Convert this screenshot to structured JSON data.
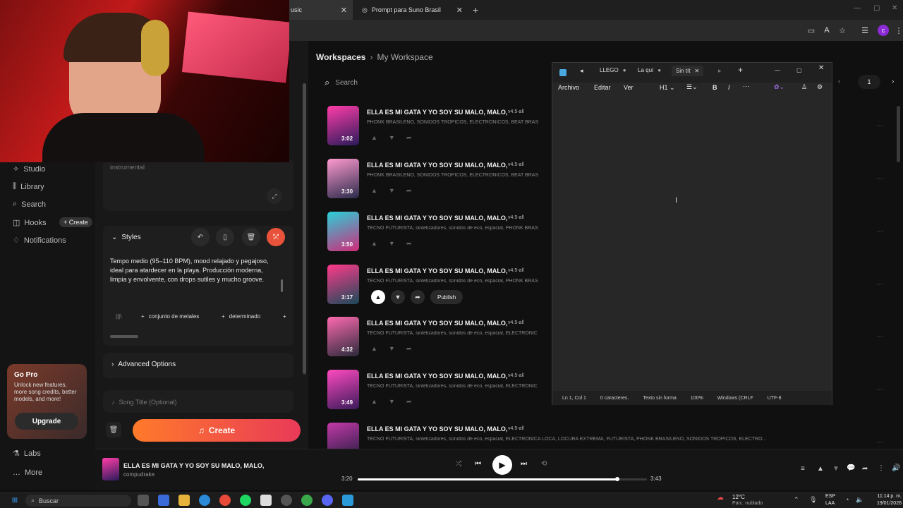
{
  "browser": {
    "tabs": [
      {
        "label": "usic"
      },
      {
        "label": "Prompt para Suno Brasil"
      }
    ],
    "new_tab": "+",
    "profile_initial": "c"
  },
  "sidebar": {
    "items": [
      {
        "label": "Studio",
        "icon": "studio-icon"
      },
      {
        "label": "Library",
        "icon": "library-icon"
      },
      {
        "label": "Search",
        "icon": "search-icon"
      },
      {
        "label": "Hooks",
        "icon": "hooks-icon"
      },
      {
        "label": "Notifications",
        "icon": "bell-icon"
      }
    ],
    "create_pill": "+ Create",
    "go_pro": {
      "title": "Go Pro",
      "text": "Unlock new features, more song credits, better models, and more!",
      "button": "Upgrade"
    },
    "labs": "Labs",
    "more": "More"
  },
  "create_panel": {
    "lyrics_placeholder": "instrumental",
    "styles_label": "Styles",
    "styles_text": "Tempo medio (95–110 BPM), mood relajado y pegajoso, ideal para atardecer en la playa. Producción moderna, limpia y envolvente, con drops sutiles y mucho groove.",
    "chips": [
      "conjunto de metales",
      "determinado"
    ],
    "advanced_options": "Advanced Options",
    "song_title_placeholder": "Song Title (Optional)",
    "create_button": "Create"
  },
  "workspace": {
    "breadcrumb_root": "Workspaces",
    "breadcrumb_current": "My Workspace",
    "search_placeholder": "Search",
    "page": "1"
  },
  "songs": [
    {
      "title": "ELLA ES MI GATA Y YO SOY SU MALO, MALO,",
      "version": "v4.5-all",
      "tags": "PHONK BRASILEÑO, SONIDOS TROPICOS, ELECTRONICOS, BEAT BRAS",
      "duration": "3:02"
    },
    {
      "title": "ELLA ES MI GATA Y YO SOY SU MALO, MALO,",
      "version": "v4.5-all",
      "tags": "PHONK BRASILEÑO, SONIDOS TROPICOS, ELECTRONICOS, BEAT BRAS",
      "duration": "3:30"
    },
    {
      "title": "ELLA ES MI GATA Y YO SOY SU MALO, MALO,",
      "version": "v4.5-all",
      "tags": "TECNO FUTURISTA, sintetizadores, sonidos de eco, espacial, PHONK BRAS",
      "duration": "3:50"
    },
    {
      "title": "ELLA ES MI GATA Y YO SOY SU MALO, MALO,",
      "version": "v4.5-all",
      "tags": "TECNO FUTURISTA, sintetizadores, sonidos de eco, espacial, PHONK BRAS",
      "duration": "3:17",
      "publish": "Publish"
    },
    {
      "title": "ELLA ES MI GATA Y YO SOY SU MALO, MALO,",
      "version": "v4.5-all",
      "tags": "TECNO FUTURISTA, sintetizadores, sonidos de eco, espacial, ELECTRONIC",
      "duration": "4:32"
    },
    {
      "title": "ELLA ES MI GATA Y YO SOY SU MALO, MALO,",
      "version": "v4.5-all",
      "tags": "TECNO FUTURISTA, sintetizadores, sonidos de eco, espacial, ELECTRONIC",
      "duration": "3:49"
    },
    {
      "title": "ELLA ES MI GATA Y YO SOY SU MALO, MALO,",
      "version": "v4.5-all",
      "tags": "TECNO FUTURISTA, sintetizadores, sonidos de eco, espacial, ELECTRONICA LOCA, LOCURA EXTREMA, FUTURISTA, PHONK BRASILEÑO, SONIDOS TROPICOS, ELECTRO...",
      "duration": ""
    }
  ],
  "notepad": {
    "tabs": [
      "LLEGO",
      "La quí",
      "Sin tít"
    ],
    "menu": [
      "Archivo",
      "Editar",
      "Ver"
    ],
    "heading": "H1",
    "status": [
      "Ln 1, Col 1",
      "0 caracteres.",
      "Texto sin forma",
      "100%",
      "Windows (CRLF",
      "UTF-8"
    ]
  },
  "player": {
    "title": "ELLA ES MI GATA Y YO SOY SU MALO, MALO,",
    "artist": "compudrake",
    "current_time": "3:20",
    "total_time": "3:43",
    "progress": 0.897
  },
  "taskbar": {
    "search": "Buscar",
    "weather_temp": "12°C",
    "weather_text": "Parc. nublado",
    "lang": "ESP",
    "lang2": "LAA",
    "time": "11:14 p. m.",
    "date": "19/01/2026"
  }
}
